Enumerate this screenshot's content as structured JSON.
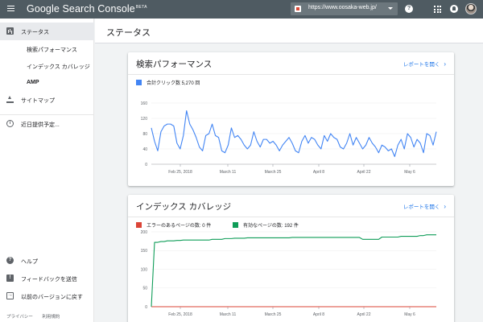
{
  "app": {
    "brand": "Google Search Console",
    "badge": "BETA",
    "property_url": "https://www.oosaka-web.jp/"
  },
  "sidebar": {
    "items": [
      {
        "label": "ステータス"
      },
      {
        "label": "検索パフォーマンス"
      },
      {
        "label": "インデックス カバレッジ"
      },
      {
        "label": "AMP"
      },
      {
        "label": "サイトマップ"
      },
      {
        "label": "近日提供予定..."
      },
      {
        "label": "ヘルプ"
      },
      {
        "label": "フィードバックを送信"
      },
      {
        "label": "以前のバージョンに戻す"
      }
    ],
    "footer": {
      "privacy": "プライバシー",
      "terms": "利用規約"
    }
  },
  "page": {
    "title": "ステータス"
  },
  "performance_card": {
    "title": "検索パフォーマンス",
    "link": "レポートを開く",
    "legend": "合計クリック数 5,270 回",
    "color": "#4285f4"
  },
  "coverage_card": {
    "title": "インデックス カバレッジ",
    "link": "レポートを開く",
    "legend_error": "エラーのあるページの数: 0 件",
    "legend_valid": "有効なページの数: 192 件",
    "error_color": "#db4437",
    "valid_color": "#0f9d58"
  },
  "chart_data": [
    {
      "type": "line",
      "x_ticks": [
        "Feb 25, 2018",
        "March 11",
        "March 25",
        "April 8",
        "April 22",
        "May 6"
      ],
      "y_ticks": [
        0,
        40,
        80,
        120,
        160
      ],
      "ylim": [
        0,
        160
      ],
      "series": [
        {
          "name": "合計クリック数",
          "values": [
            95,
            60,
            35,
            85,
            100,
            105,
            105,
            100,
            55,
            40,
            75,
            140,
            105,
            90,
            70,
            45,
            35,
            75,
            80,
            105,
            75,
            70,
            35,
            30,
            50,
            95,
            70,
            75,
            65,
            50,
            40,
            50,
            85,
            60,
            45,
            65,
            65,
            55,
            60,
            50,
            35,
            50,
            60,
            70,
            55,
            35,
            30,
            60,
            75,
            55,
            70,
            65,
            50,
            40,
            75,
            60,
            80,
            70,
            65,
            45,
            40,
            55,
            80,
            50,
            70,
            55,
            40,
            50,
            70,
            55,
            45,
            30,
            50,
            45,
            35,
            40,
            20,
            50,
            65,
            40,
            80,
            70,
            45,
            65,
            55,
            30,
            80,
            75,
            50,
            85
          ]
        }
      ]
    },
    {
      "type": "line",
      "x_ticks": [
        "Feb 25, 2018",
        "March 11",
        "March 25",
        "April 8",
        "April 22",
        "May 6"
      ],
      "y_ticks": [
        0,
        50,
        100,
        150,
        200
      ],
      "ylim": [
        0,
        200
      ],
      "series": [
        {
          "name": "エラーのあるページの数",
          "values": [
            0,
            0,
            0,
            0,
            0,
            0,
            0,
            0,
            0,
            0,
            0,
            0,
            0,
            0,
            0,
            0,
            0,
            0,
            0,
            0,
            0,
            0,
            0,
            0,
            0,
            0,
            0,
            0,
            0,
            0,
            0,
            0,
            0,
            0,
            0,
            0,
            0,
            0,
            0,
            0,
            0,
            0,
            0,
            0,
            0,
            0,
            0,
            0,
            0,
            0,
            0,
            0,
            0,
            0,
            0,
            0,
            0,
            0,
            0,
            0,
            0,
            0,
            0,
            0,
            0,
            0,
            0,
            0,
            0,
            0,
            0,
            0,
            0,
            0,
            0,
            0,
            0,
            0,
            0,
            0,
            0,
            0,
            0,
            0,
            0,
            0,
            0,
            0,
            0,
            0
          ]
        },
        {
          "name": "有効なページの数",
          "values": [
            0,
            172,
            172,
            174,
            174,
            176,
            176,
            176,
            177,
            177,
            178,
            178,
            178,
            178,
            178,
            178,
            178,
            178,
            178,
            180,
            180,
            180,
            180,
            182,
            182,
            182,
            183,
            183,
            183,
            183,
            184,
            184,
            184,
            184,
            184,
            184,
            184,
            184,
            184,
            184,
            184,
            184,
            184,
            184,
            185,
            185,
            185,
            185,
            185,
            185,
            185,
            185,
            185,
            185,
            185,
            185,
            185,
            185,
            185,
            185,
            185,
            185,
            185,
            185,
            185,
            185,
            180,
            180,
            180,
            180,
            180,
            180,
            186,
            186,
            186,
            186,
            186,
            186,
            188,
            188,
            188,
            188,
            188,
            188,
            190,
            190,
            192,
            192,
            192,
            192
          ]
        }
      ]
    }
  ]
}
